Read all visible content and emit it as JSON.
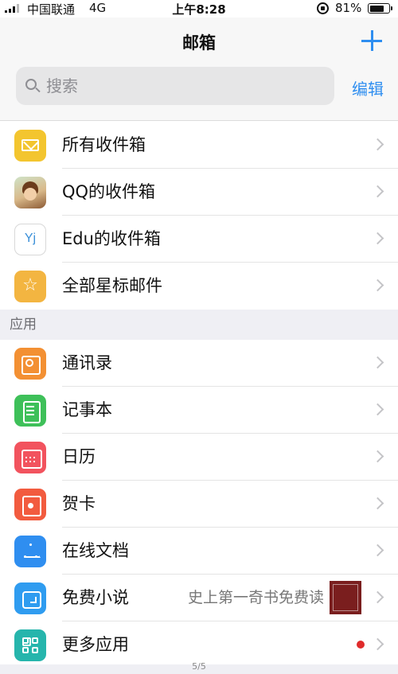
{
  "status_bar": {
    "carrier": "中国联通",
    "network": "4G",
    "time": "上午8:28",
    "battery_pct": "81%",
    "battery_level": 0.81
  },
  "header": {
    "title": "邮箱",
    "search_placeholder": "搜索",
    "edit_label": "编辑"
  },
  "mailboxes": [
    {
      "label": "所有收件箱",
      "icon": "envelope-icon"
    },
    {
      "label": "QQ的收件箱",
      "icon": "avatar-icon"
    },
    {
      "label": "Edu的收件箱",
      "icon": "yj-icon",
      "icon_text": "Yj"
    },
    {
      "label": "全部星标邮件",
      "icon": "star-icon",
      "icon_text": "☆"
    }
  ],
  "apps_section": {
    "title": "应用",
    "items": [
      {
        "label": "通讯录",
        "icon": "contacts-icon"
      },
      {
        "label": "记事本",
        "icon": "notes-icon"
      },
      {
        "label": "日历",
        "icon": "calendar-icon"
      },
      {
        "label": "贺卡",
        "icon": "card-icon"
      },
      {
        "label": "在线文档",
        "icon": "docs-icon"
      },
      {
        "label": "免费小说",
        "icon": "novel-icon",
        "extra": "史上第一奇书免费读"
      },
      {
        "label": "更多应用",
        "icon": "more-apps-icon"
      }
    ]
  },
  "pager": "5/5",
  "colors": {
    "accent": "#2e8ef0",
    "section_bg": "#efeff4"
  }
}
